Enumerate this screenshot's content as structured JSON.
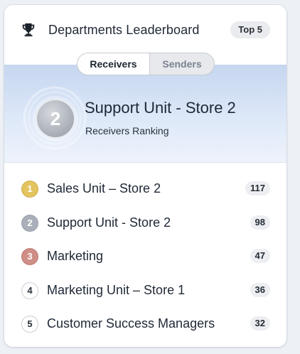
{
  "header": {
    "title": "Departments Leaderboard",
    "badge": "Top 5",
    "icon": "trophy-icon"
  },
  "tabs": [
    {
      "label": "Receivers",
      "active": true
    },
    {
      "label": "Senders",
      "active": false
    }
  ],
  "featured": {
    "rank": "2",
    "name": "Support Unit - Store 2",
    "subtitle": "Receivers Ranking"
  },
  "leaderboard": [
    {
      "rank": "1",
      "name": "Sales Unit – Store 2",
      "count": "117",
      "medal": "gold"
    },
    {
      "rank": "2",
      "name": "Support Unit - Store 2",
      "count": "98",
      "medal": "silver"
    },
    {
      "rank": "3",
      "name": "Marketing",
      "count": "47",
      "medal": "bronze"
    },
    {
      "rank": "4",
      "name": "Marketing Unit – Store 1",
      "count": "36",
      "medal": "none"
    },
    {
      "rank": "5",
      "name": "Customer Success Managers",
      "count": "32",
      "medal": "none"
    }
  ],
  "colors": {
    "gold": "#e3c45f",
    "silver": "#aab0b9",
    "bronze": "#cf8e86",
    "hero_background": "#c6d6f0"
  }
}
